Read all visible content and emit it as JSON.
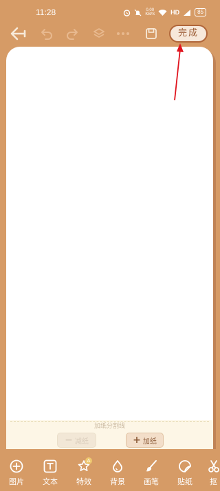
{
  "status_bar": {
    "time": "11:28",
    "net_speed_value": "0.00",
    "net_speed_unit": "KB/S",
    "hd": "HD",
    "battery": "85"
  },
  "toolbar": {
    "back_icon": "back-arrow-icon",
    "undo_icon": "undo-icon",
    "redo_icon": "redo-icon",
    "layers_icon": "layers-icon",
    "more_icon": "more-icon",
    "save_icon": "save-icon",
    "done_label": "完成"
  },
  "paper": {
    "divider_label": "加纸分割线",
    "reduce_label": "减纸",
    "add_label": "加纸"
  },
  "bottom_bar": {
    "items": [
      {
        "label": "图片",
        "icon": "add-image-icon"
      },
      {
        "label": "文本",
        "icon": "text-icon"
      },
      {
        "label": "特效",
        "icon": "effects-icon",
        "badge": "A"
      },
      {
        "label": "背景",
        "icon": "background-icon"
      },
      {
        "label": "画笔",
        "icon": "brush-icon"
      },
      {
        "label": "贴纸",
        "icon": "sticker-icon"
      },
      {
        "label": "抠",
        "icon": "scissors-icon"
      }
    ]
  },
  "colors": {
    "background": "#d69b66",
    "paper": "#ffffff",
    "accent_dark": "#b0663a",
    "annotation_arrow": "#e0141e"
  }
}
